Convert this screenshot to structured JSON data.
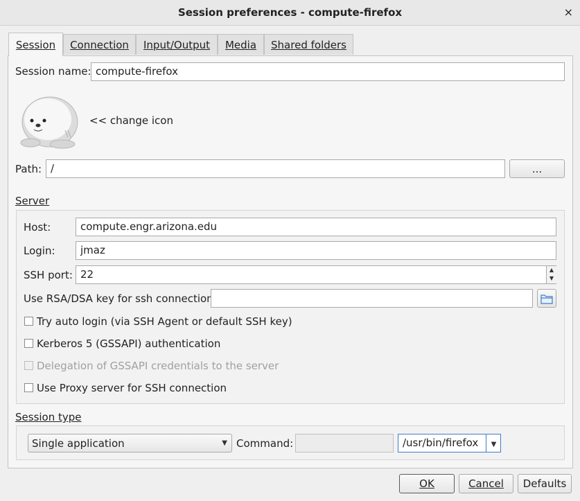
{
  "window": {
    "title": "Session preferences - compute-firefox",
    "close_glyph": "×"
  },
  "tabs": [
    {
      "label": "Session"
    },
    {
      "label": "Connection"
    },
    {
      "label": "Input/Output"
    },
    {
      "label": "Media"
    },
    {
      "label": "Shared folders"
    }
  ],
  "session": {
    "name_label": "Session name:",
    "name_value": "compute-firefox",
    "change_icon_label": "<< change icon",
    "path_label": "Path:",
    "path_value": "/",
    "browse_label": "..."
  },
  "server": {
    "group_label": "Server",
    "host_label": "Host:",
    "host_value": "compute.engr.arizona.edu",
    "login_label": "Login:",
    "login_value": "jmaz",
    "ssh_port_label": "SSH port:",
    "ssh_port_value": "22",
    "rsa_label": "Use RSA/DSA key for ssh connection:",
    "rsa_value": "",
    "auto_login_label": "Try auto login (via SSH Agent or default SSH key)",
    "kerberos_label": "Kerberos 5 (GSSAPI) authentication",
    "delegation_label": "Delegation of GSSAPI credentials to the server",
    "proxy_label": "Use Proxy server for SSH connection"
  },
  "session_type": {
    "group_label": "Session type",
    "type_value": "Single application",
    "command_label": "Command:",
    "command_value": "",
    "app_value": "/usr/bin/firefox"
  },
  "buttons": {
    "ok": "OK",
    "cancel": "Cancel",
    "defaults": "Defaults"
  },
  "colors": {
    "folder_icon": "#3d7cc9",
    "window_bg": "#efefef",
    "panel_bg": "#f6f6f6"
  }
}
